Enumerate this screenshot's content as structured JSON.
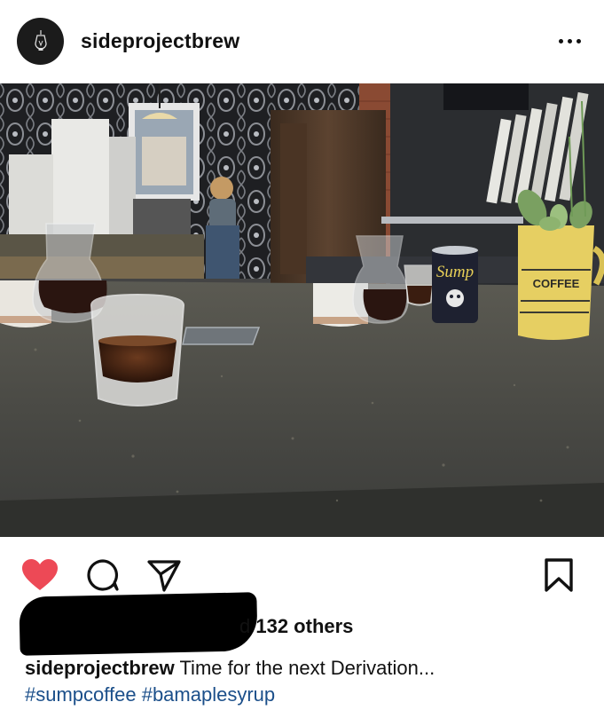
{
  "post": {
    "username": "sideprojectbrew",
    "icons": {
      "avatar": "lightbulb-logo-icon",
      "more": "more-options-icon",
      "like": "heart-filled-icon",
      "comment": "comment-icon",
      "share": "send-icon",
      "save": "bookmark-icon"
    },
    "colors": {
      "like": "#ed4956",
      "hashtag": "#1b4f8a"
    },
    "likes": {
      "visible_fragment": "d ",
      "count_text": "132 others"
    },
    "caption": {
      "username": "sideprojectbrew",
      "text": "Time for the next Derivation..."
    },
    "hashtags": [
      "#sumpcoffee",
      "#bamaplesyrup"
    ],
    "photo": {
      "can_label": "Sump",
      "pitcher_label": "COFFEE"
    }
  }
}
